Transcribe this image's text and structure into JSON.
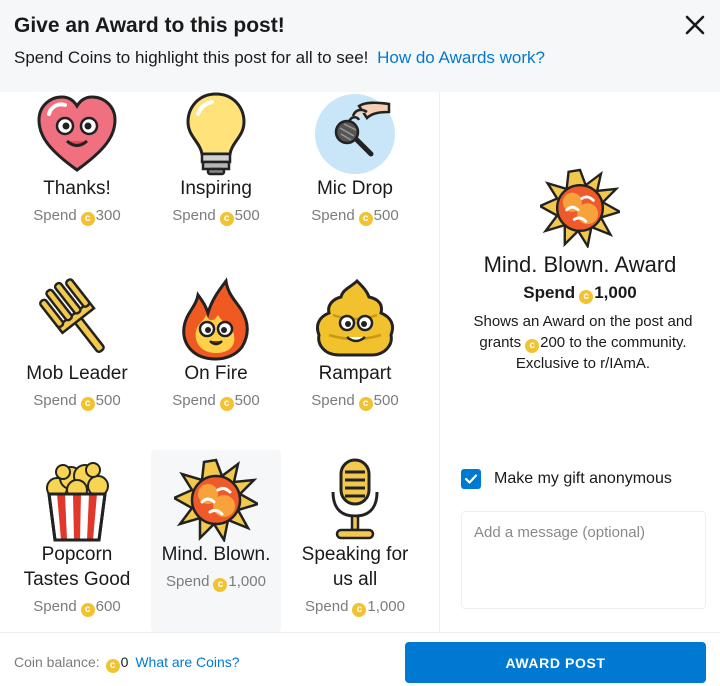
{
  "dialog": {
    "title": "Give an Award to this post!",
    "subtitle": "Spend Coins to highlight this post for all to see!",
    "help_link": "How do Awards work?"
  },
  "awards": [
    {
      "name": "Thanks!",
      "spend_label": "Spend",
      "price": "300",
      "icon": "heart-icon"
    },
    {
      "name": "Inspiring",
      "spend_label": "Spend",
      "price": "500",
      "icon": "lightbulb-icon"
    },
    {
      "name": "Mic Drop",
      "spend_label": "Spend",
      "price": "500",
      "icon": "mic-drop-icon"
    },
    {
      "name": "Mob Leader",
      "spend_label": "Spend",
      "price": "500",
      "icon": "pitchfork-icon"
    },
    {
      "name": "On Fire",
      "spend_label": "Spend",
      "price": "500",
      "icon": "fire-icon"
    },
    {
      "name": "Rampart",
      "spend_label": "Spend",
      "price": "500",
      "icon": "poop-icon"
    },
    {
      "name": "Popcorn Tastes Good",
      "spend_label": "Spend",
      "price": "600",
      "icon": "popcorn-icon"
    },
    {
      "name": "Mind. Blown.",
      "spend_label": "Spend",
      "price": "1,000",
      "icon": "explosion-icon",
      "selected": true
    },
    {
      "name": "Speaking for us all",
      "spend_label": "Spend",
      "price": "1,000",
      "icon": "microphone-icon"
    }
  ],
  "selected_award": {
    "name": "Mind. Blown. Award",
    "spend_label": "Spend",
    "price": "1,000",
    "desc_before": "Shows an Award on the post and grants",
    "desc_coins": "200",
    "desc_after": "to the community. Exclusive to r/IAmA."
  },
  "options": {
    "anonymous_label": "Make my gift anonymous",
    "anonymous_checked": true,
    "message_placeholder": "Add a message (optional)"
  },
  "footer": {
    "balance_label": "Coin balance:",
    "balance_value": "0",
    "coins_link": "What are Coins?",
    "award_button": "AWARD POST"
  },
  "colors": {
    "accent": "#0079d3",
    "coin": "#f1c232",
    "header_bg": "#f6f7f8"
  }
}
